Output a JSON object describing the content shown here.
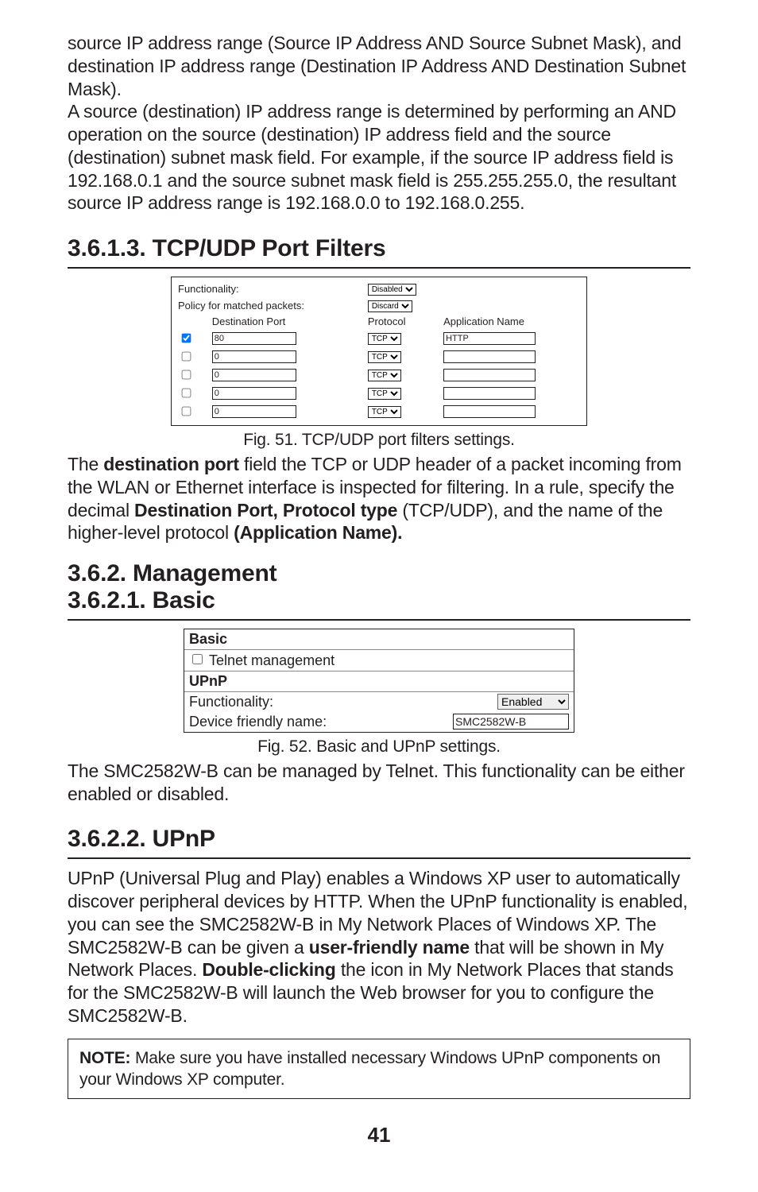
{
  "intro_paragraph": "source IP address range (Source IP Address AND Source Subnet Mask), and destination IP address range (Destination IP Address AND Destination Subnet Mask).\nA source (destination) IP address range is determined by performing an AND operation on the source (destination) IP address field and the source (destination) subnet mask field. For example, if the source IP address field is 192.168.0.1 and the source subnet mask field is 255.255.255.0, the resultant source IP address range is 192.168.0.0 to 192.168.0.255.",
  "sections": {
    "s36113_title": "3.6.1.3. TCP/UDP Port Filters",
    "s362_title": "3.6.2. Management",
    "s3621_title": "3.6.2.1. Basic",
    "s3622_title": "3.6.2.2. UPnP"
  },
  "fig51": {
    "caption": "Fig. 51. TCP/UDP port filters settings.",
    "labels": {
      "functionality": "Functionality:",
      "policy": "Policy for matched packets:",
      "dest_port": "Destination Port",
      "protocol": "Protocol",
      "app_name": "Application Name"
    },
    "selects": {
      "functionality_value": "Disabled",
      "policy_value": "Discard",
      "protocol_option": "TCP"
    },
    "rows": [
      {
        "checked": true,
        "dest_port": "80",
        "app_name": "HTTP"
      },
      {
        "checked": false,
        "dest_port": "0",
        "app_name": ""
      },
      {
        "checked": false,
        "dest_port": "0",
        "app_name": ""
      },
      {
        "checked": false,
        "dest_port": "0",
        "app_name": ""
      },
      {
        "checked": false,
        "dest_port": "0",
        "app_name": ""
      }
    ]
  },
  "post_fig51_paragraph": {
    "pre": "The ",
    "bold1": "destination port",
    "mid1": "  field the TCP or UDP header of a packet incoming from the WLAN or Ethernet interface is inspected for filtering. In a rule, specify the decimal ",
    "bold2": "Destination Port, Protocol type",
    "mid2": "  (TCP/UDP), and the name of the higher-level protocol ",
    "bold3": "(Application Name).",
    "end": ""
  },
  "fig52": {
    "caption": "Fig. 52. Basic and UPnP settings.",
    "labels": {
      "basic_hdr": "Basic",
      "telnet_row": "Telnet management",
      "upnp_hdr": "UPnP",
      "functionality": "Functionality:",
      "dev_friendly": "Device friendly name:"
    },
    "values": {
      "telnet_checked": false,
      "functionality_value": "Enabled",
      "dev_friendly_value": "SMC2582W-B"
    }
  },
  "post_fig52_paragraph": "The SMC2582W-B can be managed by Telnet. This functionality can be either enabled or disabled.",
  "upnp_paragraph": {
    "pre": "UPnP (Universal Plug and Play) enables a Windows XP user to automatically discover peripheral devices by HTTP. When the UPnP functionality is enabled, you can see the SMC2582W-B in My Network Places of Windows XP. The SMC2582W-B can be given a ",
    "bold1": "user-friendly name",
    "mid1": "  that will be shown in My Network Places. ",
    "bold2": "Double-clicking",
    "mid2": "  the icon in My Network Places that stands for the SMC2582W-B will launch the Web browser for you to configure the SMC2582W-B."
  },
  "note": {
    "label": "NOTE:",
    "text": " Make sure you have installed necessary Windows UPnP components on your Windows XP computer."
  },
  "page_number": "41"
}
